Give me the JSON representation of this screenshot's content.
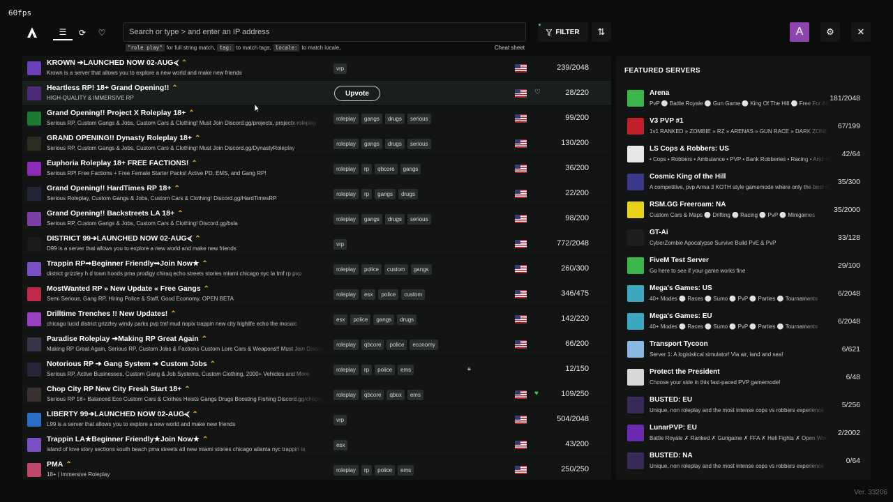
{
  "fps": "60fps",
  "nav": {
    "logo": "altv-logo-icon",
    "items": [
      {
        "name": "list-icon",
        "glyph": "☰"
      },
      {
        "name": "history-icon",
        "glyph": "⟳"
      },
      {
        "name": "favorites-icon",
        "glyph": "♡"
      }
    ]
  },
  "search": {
    "placeholder": "Search or type > and enter an IP address",
    "value": "",
    "hint_code1": "\"role play\"",
    "hint_text1": "for full string match,",
    "hint_code2": "tag:",
    "hint_text2": "to match tags,",
    "hint_code3": "locale:",
    "hint_text3": "to match locale,",
    "cheat_sheet": "Cheat sheet"
  },
  "toolbar": {
    "filter_label": "FILTER",
    "sort_icon": "⇅",
    "avatar_letter": "A",
    "avatar_color": "#8e44ad",
    "settings_icon": "⚙",
    "close_icon": "✕"
  },
  "upvote_label": "Upvote",
  "servers": [
    {
      "title": "KROWN ➔LAUNCHED NOW 02-AUG⮘",
      "desc": "Krown is a server that allows you to explore a new world and make new friends",
      "tags": [
        "vrp"
      ],
      "players": "239/2048",
      "flag": true,
      "icon": "#6b3fb8"
    },
    {
      "title": "Heartless RP! 18+ Grand Opening!!",
      "desc": "HIGH-QUALITY & IMMERSIVE RP",
      "tags": [],
      "upvote": true,
      "players": "28/220",
      "flag": true,
      "heart": "white",
      "icon": "#4b2a7a"
    },
    {
      "title": "Grand Opening!! Project X Roleplay 18+",
      "desc": "Serious RP, Custom Gangs & Jobs, Custom Cars & Clothing! Must Join Discord.gg/projectx, projectx roleplay",
      "tags": [
        "roleplay",
        "gangs",
        "drugs",
        "serious"
      ],
      "players": "99/200",
      "flag": true,
      "icon": "#1e7a32"
    },
    {
      "title": "GRAND OPENING!! Dynasty Roleplay 18+",
      "desc": "Serious RP, Custom Gangs & Jobs, Custom Cars & Clothing! Must Join Discord.gg/DynastyRoleplay",
      "tags": [
        "roleplay",
        "gangs",
        "drugs",
        "serious"
      ],
      "players": "130/200",
      "flag": true,
      "icon": "#2d2a20"
    },
    {
      "title": "Euphoria Roleplay 18+ FREE FACTIONS!",
      "desc": "Serious RP! Free Factions + Free Female Starter Packs! Active PD, EMS, and Gang RP!",
      "tags": [
        "roleplay",
        "rp",
        "qbcore",
        "gangs"
      ],
      "players": "36/200",
      "flag": true,
      "icon": "#8a2bb5"
    },
    {
      "title": "Grand Opening!! HardTimes RP 18+",
      "desc": "Serious Roleplay, Custom Gangs & Jobs, Custom Cars & Clothing! Discord.gg/HardTimesRP",
      "tags": [
        "roleplay",
        "rp",
        "gangs",
        "drugs"
      ],
      "players": "22/200",
      "flag": true,
      "icon": "#25253a"
    },
    {
      "title": "Grand Opening!! Backstreets LA 18+",
      "desc": "Serious RP, Custom Gangs & Jobs, Custom Cars & Clothing! Discord.gg/bsla",
      "tags": [
        "roleplay",
        "gangs",
        "drugs",
        "serious"
      ],
      "players": "98/200",
      "flag": true,
      "icon": "#7b3fa8"
    },
    {
      "title": "DISTRICT 99➔LAUNCHED NOW 02-AUG⮘",
      "desc": "D99 is a server that allows you to explore a new world and make new friends",
      "tags": [
        "vrp"
      ],
      "players": "772/2048",
      "flag": true,
      "icon": "#1a1c1b"
    },
    {
      "title": "Trappin RP➟Beginner Friendly➟Join Now★",
      "desc": "district grizzley h d town hoods pma prodigy chiraq echo streets stories miami chicago nyc la tmf rp pvp",
      "tags": [
        "roleplay",
        "police",
        "custom",
        "gangs"
      ],
      "players": "260/300",
      "flag": true,
      "icon": "#7a4fc2"
    },
    {
      "title": "MostWanted RP » New Update « Free Gangs",
      "desc": "Semi Serious, Gang RP, Hiring Police & Staff, Good Economy, OPEN BETA",
      "tags": [
        "roleplay",
        "esx",
        "police",
        "custom"
      ],
      "players": "346/475",
      "flag": true,
      "icon": "#c0284a"
    },
    {
      "title": "Drilltime Trenches !! New Updates!",
      "desc": "chicago lucid district grizzley windy parks pvp tmf mud nopix trappin new city highlife echo the mosaic",
      "tags": [
        "esx",
        "police",
        "gangs",
        "drugs"
      ],
      "players": "142/220",
      "flag": true,
      "icon": "#9b3fc2"
    },
    {
      "title": "Paradise Roleplay ➔Making RP Great Again",
      "desc": "Making RP Great Again, Serious RP, Custom Jobs & Factions Custom Lore Cars & Weapons!! Must Join Discord",
      "tags": [
        "roleplay",
        "qbcore",
        "police",
        "economy"
      ],
      "players": "66/200",
      "flag": true,
      "icon": "#3a3348"
    },
    {
      "title": "Notorious RP ➔ Gang System ➔ Custom Jobs",
      "desc": "Serious RP, Active Businesses, Custom Gang & Job Systems, Custom Clothing, 2000+ Vehicles and More",
      "tags": [
        "roleplay",
        "rp",
        "police",
        "ems"
      ],
      "players": "12/150",
      "flag": false,
      "lock": true,
      "icon": "#2a2438"
    },
    {
      "title": "Chop City RP New City Fresh Start 18+",
      "desc": "Serious RP 18+ Balanced Eco Custom Cars & Clothes Heists Gangs Drugs Boosting Fishing Discord.gg/chopcity",
      "tags": [
        "roleplay",
        "qbcore",
        "qbox",
        "ems"
      ],
      "players": "109/250",
      "flag": true,
      "heart": "green",
      "icon": "#3a3030"
    },
    {
      "title": "LIBERTY 99➔LAUNCHED NOW 02-AUG⮘",
      "desc": "L99 is a server that allows you to explore a new world and make new friends",
      "tags": [
        "vrp"
      ],
      "players": "504/2048",
      "flag": true,
      "icon": "#2b6cc4"
    },
    {
      "title": "Trappin LA★Beginner Friendly★Join Now★",
      "desc": "island of love story sections south beach pma streets atl new miami stories chicago atlanta nyc trappin la",
      "tags": [
        "esx"
      ],
      "players": "43/200",
      "flag": true,
      "icon": "#7a4fc2"
    },
    {
      "title": "PMA",
      "desc": "18+ | Immersive Roleplay",
      "tags": [
        "roleplay",
        "rp",
        "police",
        "ems"
      ],
      "players": "250/250",
      "flag": true,
      "icon": "#c0486a"
    }
  ],
  "featured": {
    "heading": "FEATURED SERVERS",
    "items": [
      {
        "title": "Arena",
        "desc": "PvP ⚪ Battle Royale ⚪ Gun Game ⚪ King Of The Hill ⚪ Free For All",
        "players": "181/2048",
        "icon": "#3bb54a"
      },
      {
        "title": "V3 PVP #1",
        "desc": "1v1 RANKED » ZOMBIE » RZ » ARENAS » GUN RACE » DARK ZONE",
        "players": "67/199",
        "icon": "#c0202a"
      },
      {
        "title": "LS Cops & Robbers: US",
        "desc": "• Cops • Robbers • Ambulance • PVP • Bank Robberies • Racing • And more",
        "players": "42/64",
        "icon": "#e8e8e8"
      },
      {
        "title": "Cosmic King of the Hill",
        "desc": "A competitive, pvp Arma 3 KOTH style gamemode where only the best survive",
        "players": "35/300",
        "icon": "#3a3a8a"
      },
      {
        "title": "RSM.GG Freeroam: NA",
        "desc": "Custom Cars & Maps ⚪ Drifting ⚪ Racing ⚪ PvP ⚪ Minigames",
        "players": "35/2000",
        "icon": "#e8d21a"
      },
      {
        "title": "GT-Ai",
        "desc": "CyberZombie Apocalypse Survive Build PvE & PvP",
        "players": "33/128",
        "icon": "#1e1e1e"
      },
      {
        "title": "FiveM Test Server",
        "desc": "Go here to see if your game works fine",
        "players": "29/100",
        "icon": "#3bb54a"
      },
      {
        "title": "Mega's Games: US",
        "desc": "40+ Modes ⚪ Races ⚪ Sumo ⚪ PvP ⚪ Parties ⚪ Tournaments",
        "players": "6/2048",
        "icon": "#3ba8c0"
      },
      {
        "title": "Mega's Games: EU",
        "desc": "40+ Modes ⚪ Races ⚪ Sumo ⚪ PvP ⚪ Parties ⚪ Tournaments",
        "players": "6/2048",
        "icon": "#3ba8c0"
      },
      {
        "title": "Transport Tycoon",
        "desc": "Server 1: A logisistical simulator! Via air, land and sea!",
        "players": "6/621",
        "icon": "#8ab8e0"
      },
      {
        "title": "Protect the President",
        "desc": "Choose your side in this fast-paced PVP gamemode!",
        "players": "6/48",
        "icon": "#d8d8d8"
      },
      {
        "title": "BUSTED: EU",
        "desc": "Unique, non roleplay and the most intense cops vs robbers experience",
        "players": "5/256",
        "icon": "#3a2a5a"
      },
      {
        "title": "LunarPVP: EU",
        "desc": "Battle Royale ✗ Ranked ✗ Gungame ✗ FFA ✗ Heli Fights ✗ Open World",
        "players": "2/2002",
        "icon": "#6a2ab0"
      },
      {
        "title": "BUSTED: NA",
        "desc": "Unique, non roleplay and the most intense cops vs robbers experience",
        "players": "0/64",
        "icon": "#3a2a5a"
      }
    ]
  },
  "version": "Ver. 33206"
}
